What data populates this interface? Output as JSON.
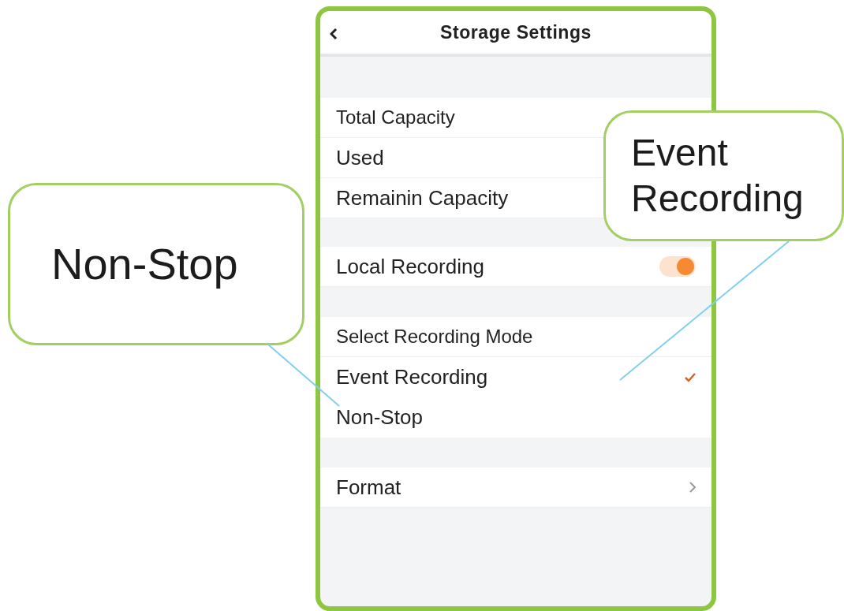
{
  "screen": {
    "title": "Storage Settings",
    "sections": [
      {
        "rows": [
          {
            "kind": "info",
            "label": "Total Capacity"
          },
          {
            "kind": "info",
            "label": "Used"
          },
          {
            "kind": "info",
            "label": "Remainin Capacity"
          }
        ]
      },
      {
        "rows": [
          {
            "kind": "toggle",
            "label": "Local Recording",
            "on": true
          }
        ]
      },
      {
        "rows": [
          {
            "kind": "heading",
            "label": "Select Recording Mode"
          },
          {
            "kind": "option",
            "label": "Event Recording",
            "selected": true
          },
          {
            "kind": "option",
            "label": "Non-Stop",
            "selected": false
          }
        ]
      },
      {
        "rows": [
          {
            "kind": "link",
            "label": "Format"
          }
        ]
      }
    ]
  },
  "callouts": [
    {
      "text": "Non-Stop"
    },
    {
      "text": "Event\nRecording"
    }
  ]
}
